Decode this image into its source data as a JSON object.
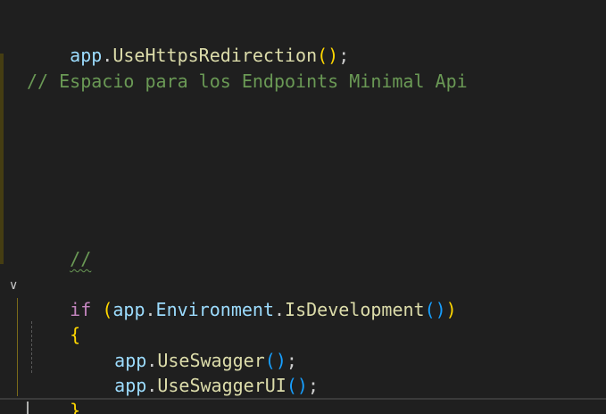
{
  "editor": {
    "lines": {
      "l1": {
        "obj": "app",
        "dot": ".",
        "method": "UseHttpsRedirection",
        "open": "(",
        "close": ")",
        "end": ";"
      },
      "l2": {
        "comment": "// Espacio para los Endpoints Minimal Api"
      },
      "l3": {
        "comment": "//"
      },
      "l4": {
        "kw": "if",
        "sp": " ",
        "open": "(",
        "obj": "app",
        "dot1": ".",
        "prop": "Environment",
        "dot2": ".",
        "method": "IsDevelopment",
        "open2": "(",
        "close2": ")",
        "close": ")"
      },
      "l5": {
        "brace": "{"
      },
      "l6": {
        "obj": "app",
        "dot": ".",
        "method": "UseSwagger",
        "open": "(",
        "close": ")",
        "end": ";"
      },
      "l7": {
        "obj": "app",
        "dot": ".",
        "method": "UseSwaggerUI",
        "open": "(",
        "close": ")",
        "end": ";"
      },
      "l8": {
        "brace": "}"
      }
    },
    "fold_glyph": "∨"
  },
  "colors": {
    "background": "#1f1f1f",
    "identifier": "#9cdcfe",
    "method": "#dcdcaa",
    "comment": "#6a9955",
    "keyword": "#c586c0",
    "bracket_level1": "#ffd700",
    "bracket_level2": "#da70d6",
    "bracket_level3": "#179fff"
  }
}
